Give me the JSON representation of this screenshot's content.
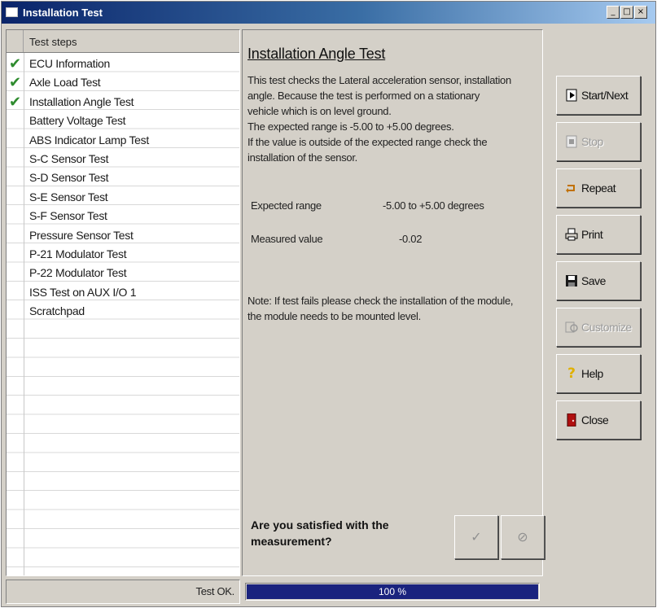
{
  "window": {
    "title": "Installation Test",
    "controls": [
      "_",
      "□",
      "×"
    ]
  },
  "steps_panel": {
    "header": "Test steps",
    "items": [
      {
        "label": "ECU Information",
        "passed": true
      },
      {
        "label": "Axle Load Test",
        "passed": true
      },
      {
        "label": "Installation Angle Test",
        "passed": true
      },
      {
        "label": "Battery Voltage Test",
        "passed": false
      },
      {
        "label": "ABS Indicator Lamp Test",
        "passed": false
      },
      {
        "label": "S-C Sensor Test",
        "passed": false
      },
      {
        "label": "S-D Sensor Test",
        "passed": false
      },
      {
        "label": "S-E Sensor Test",
        "passed": false
      },
      {
        "label": "S-F Sensor Test",
        "passed": false
      },
      {
        "label": "Pressure Sensor Test",
        "passed": false
      },
      {
        "label": "P-21 Modulator Test",
        "passed": false
      },
      {
        "label": "P-22 Modulator Test",
        "passed": false
      },
      {
        "label": "ISS Test on AUX I/O 1",
        "passed": false
      },
      {
        "label": "Scratchpad",
        "passed": false
      }
    ],
    "check_glyph": "✔"
  },
  "test": {
    "title": "Installation Angle Test",
    "description": [
      "This test checks the Lateral acceleration sensor, installation",
      "angle. Because the test is performed on a stationary",
      "vehicle which is on level ground.",
      "The expected range is -5.00 to +5.00 degrees.",
      "If the value is outside of the expected range check the",
      "installation of the sensor."
    ],
    "expected_range_label": "Expected range",
    "expected_range_value": "-5.00  to  +5.00  degrees",
    "measured_value_label": "Measured value",
    "measured_value": "-0.02",
    "note": [
      "Note: If test fails please check the installation of the module,",
      "the module needs to be mounted level."
    ],
    "question": [
      "Are you satisfied with the",
      "measurement?"
    ],
    "accept_glyph": "✓",
    "reject_glyph": "⊘"
  },
  "buttons": {
    "start_next": "Start/Next",
    "stop": "Stop",
    "repeat": "Repeat",
    "print": "Print",
    "save": "Save",
    "customize": "Customize",
    "help": "Help",
    "close": "Close"
  },
  "icons": {
    "start_next": "play-icon",
    "stop": "stop-icon",
    "repeat": "repeat-icon",
    "print": "printer-icon",
    "save": "floppy-disk-icon",
    "customize": "customize-icon",
    "help": "question-mark-icon",
    "close": "exit-door-icon"
  },
  "status": {
    "text": "Test OK.",
    "progress_percent": 100,
    "progress_label": "100 %"
  },
  "colors": {
    "check": "#2e8b2e",
    "progress": "#1a237e",
    "help_icon": "#e0b000",
    "close_icon": "#b01010"
  }
}
